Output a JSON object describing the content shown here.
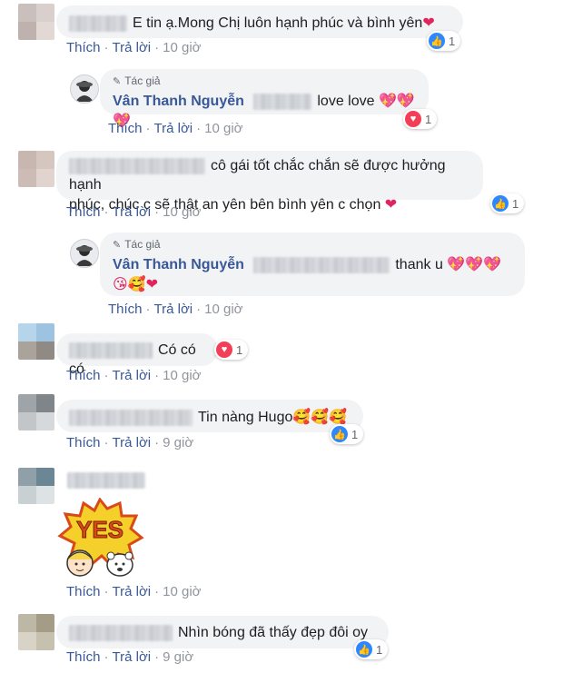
{
  "comments": [
    {
      "text": "E tin ạ.Mong Chị luôn hạnh phúc và bình yên",
      "emoji": "❤",
      "actions": {
        "like": "Thích",
        "reply": "Trả lời",
        "time": "10 giờ"
      },
      "reaction": {
        "icon": "like-icon",
        "count": "1"
      },
      "avatar_colors": [
        "#c9bfbd",
        "#d9cfcc",
        "#bfb2ae",
        "#e2d8d4"
      ]
    },
    {
      "author_tag": "Tác giả",
      "name": "Vân Thanh Nguyễn",
      "text": "love love",
      "emoji": "💖💖💖",
      "actions": {
        "like": "Thích",
        "reply": "Trả lời",
        "time": "10 giờ"
      },
      "reaction": {
        "icon": "love-icon",
        "count": "1"
      }
    },
    {
      "text_line1": "cô gái tốt chắc chắn sẽ được hưởng hạnh",
      "text_line2": "phúc, chúc c sẽ thật an yên bên bình yên c chọn",
      "emoji": "❤",
      "actions": {
        "like": "Thích",
        "reply": "Trả lời",
        "time": "10 giờ"
      },
      "reaction": {
        "icon": "like-icon",
        "count": "1"
      },
      "avatar_colors": [
        "#c8b7b0",
        "#d6c6c0",
        "#cdbcb6",
        "#e1d3cd"
      ]
    },
    {
      "author_tag": "Tác giả",
      "name": "Vân Thanh Nguyễn",
      "text": "thank u",
      "emoji": "💖💖💖",
      "emoji_line2": "😘🥰❤",
      "actions": {
        "like": "Thích",
        "reply": "Trả lời",
        "time": "10 giờ"
      }
    },
    {
      "text": "Có có có",
      "actions": {
        "like": "Thích",
        "reply": "Trả lời",
        "time": "10 giờ"
      },
      "reaction": {
        "icon": "love-icon",
        "count": "1"
      },
      "avatar_colors": [
        "#b6d4ea",
        "#9dc3e0",
        "#a9a39c",
        "#8f8a84"
      ]
    },
    {
      "text": "Tin nàng Hugo",
      "emoji": "🥰🥰🥰",
      "actions": {
        "like": "Thích",
        "reply": "Trả lời",
        "time": "9 giờ"
      },
      "reaction": {
        "icon": "like-icon",
        "count": "1"
      },
      "avatar_colors": [
        "#9ea4a8",
        "#7f8589",
        "#c2c6c9",
        "#d6d9db"
      ]
    },
    {
      "sticker_text": "YES",
      "actions": {
        "like": "Thích",
        "reply": "Trả lời",
        "time": "10 giờ"
      },
      "avatar_colors": [
        "#8fa0a8",
        "#6b8796",
        "#c9d0d3",
        "#dde2e4"
      ]
    },
    {
      "text": "Nhìn bóng đã thấy đẹp đôi oy",
      "actions": {
        "like": "Thích",
        "reply": "Trả lời",
        "time": "9 giờ"
      },
      "reaction": {
        "icon": "like-icon",
        "count": "1"
      },
      "avatar_colors": [
        "#bdb8a6",
        "#a49c86",
        "#d7d3c6",
        "#c6c0ae"
      ]
    }
  ]
}
